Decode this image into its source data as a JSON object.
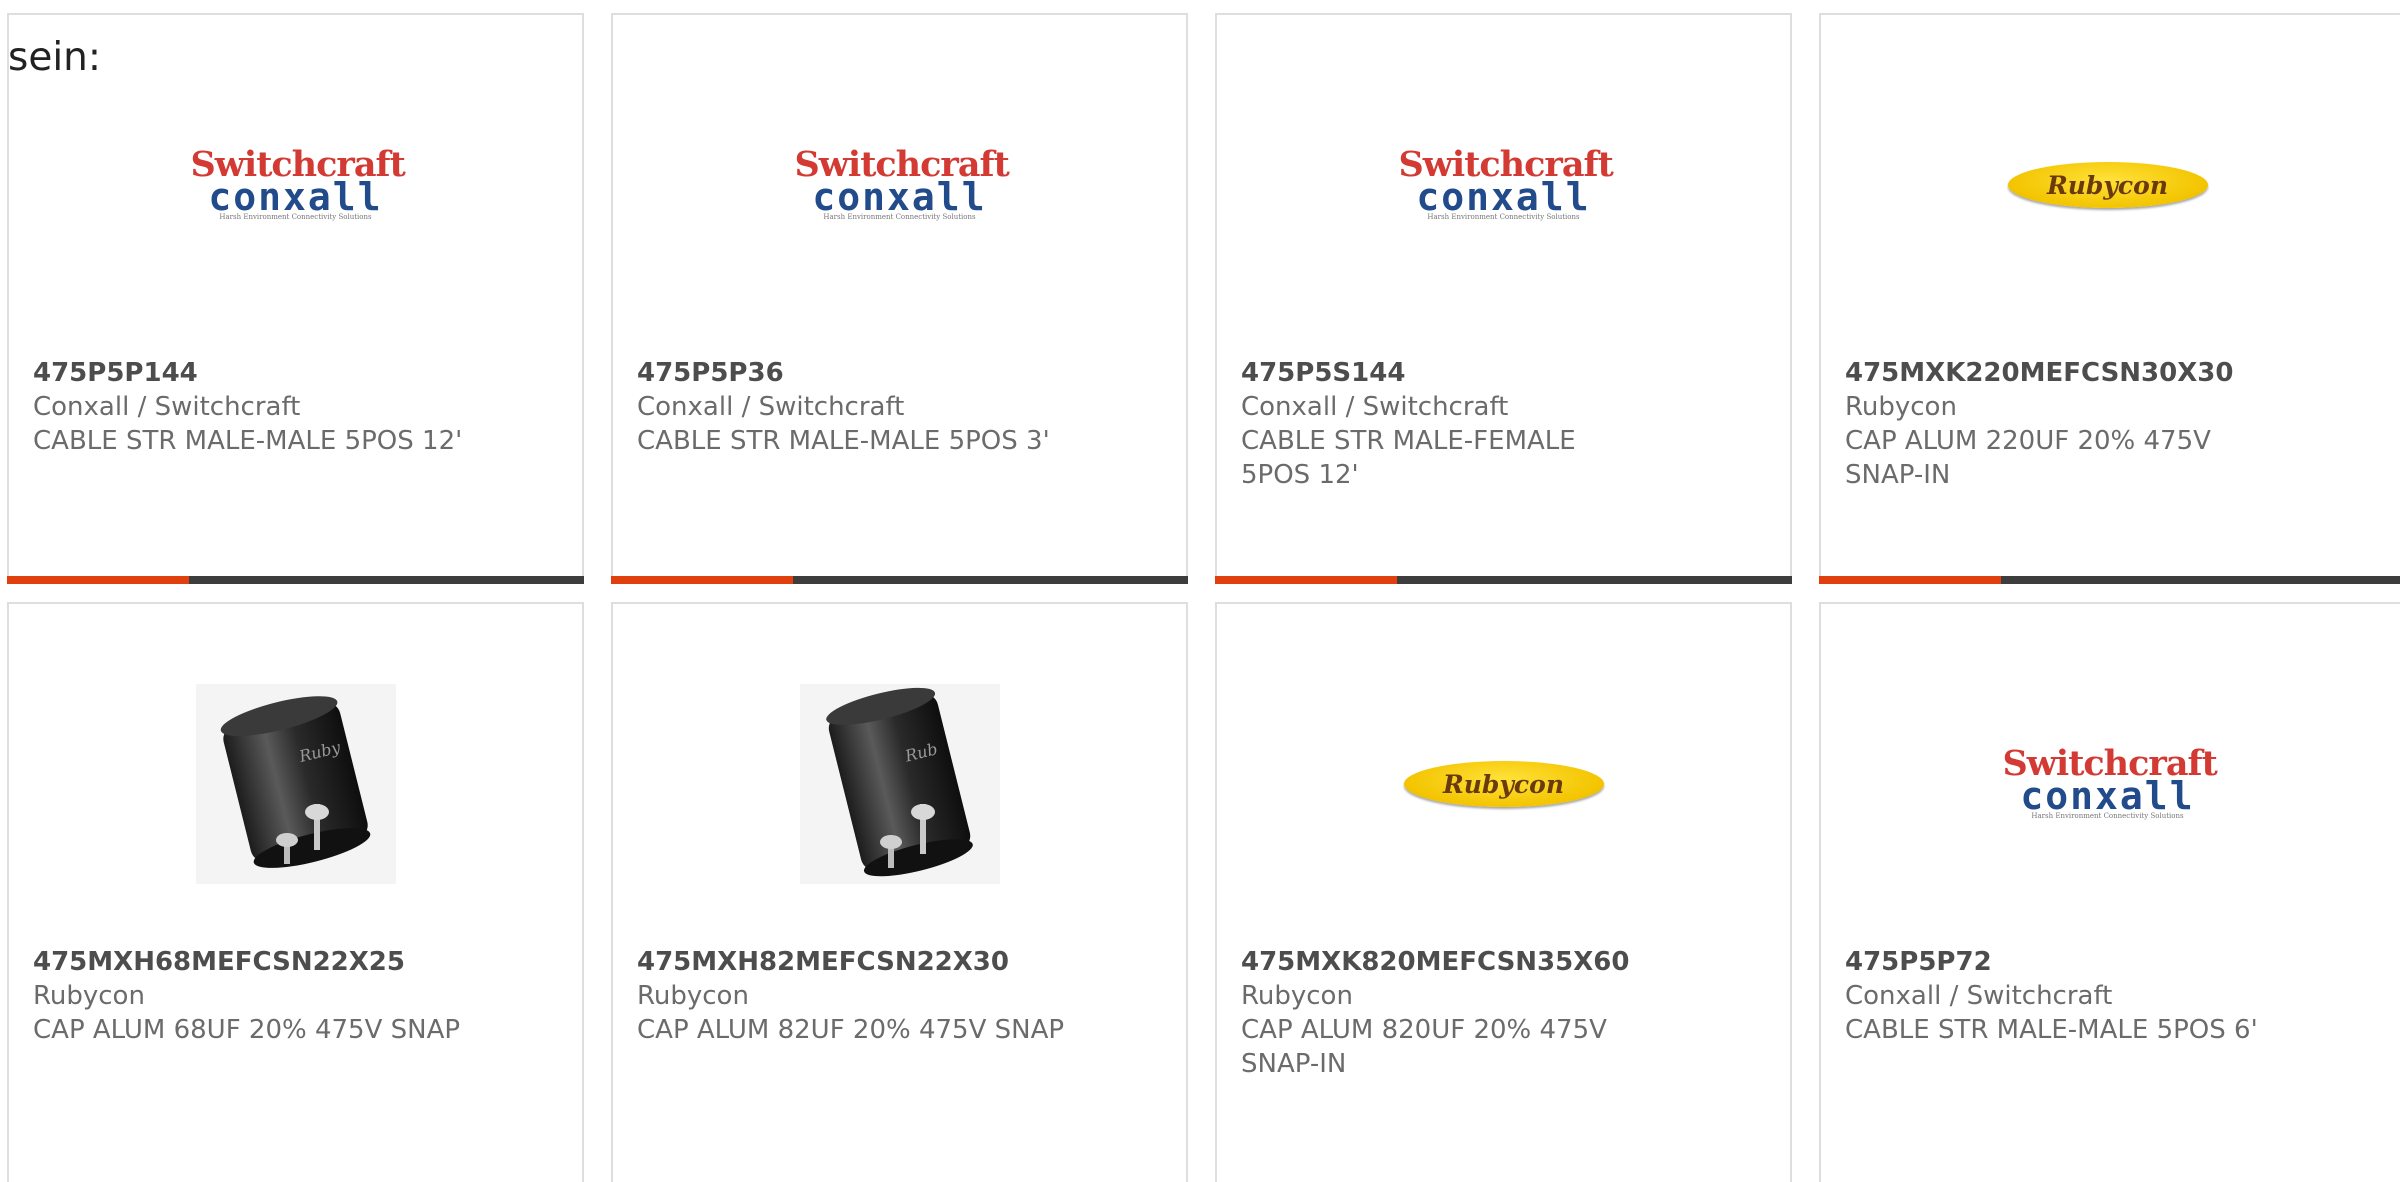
{
  "heading": "sein:",
  "colors": {
    "accent": "#e0400e",
    "bar": "#3d3d3d",
    "card_border": "#dedede",
    "text": "#6b6b6b"
  },
  "logos": {
    "switchcraft": {
      "line1": "Switchcraft",
      "line2": "conxall",
      "tagline": "Harsh Environment Connectivity Solutions"
    },
    "rubycon": {
      "text": "Rubycon"
    }
  },
  "products": [
    {
      "part": "475P5P144",
      "maker": "Conxall / Switchcraft",
      "desc": "CABLE STR MALE-MALE 5POS 12'",
      "image": "switchcraft-logo"
    },
    {
      "part": "475P5P36",
      "maker": "Conxall / Switchcraft",
      "desc": "CABLE STR MALE-MALE 5POS 3'",
      "image": "switchcraft-logo"
    },
    {
      "part": "475P5S144",
      "maker": "Conxall / Switchcraft",
      "desc": "CABLE STR MALE-FEMALE 5POS 12'",
      "image": "switchcraft-logo"
    },
    {
      "part": "475MXK220MEFCSN30X30",
      "maker": "Rubycon",
      "desc": "CAP ALUM 220UF 20% 475V SNAP-IN",
      "image": "rubycon-logo"
    },
    {
      "part": "475MXH68MEFCSN22X25",
      "maker": "Rubycon",
      "desc": "CAP ALUM 68UF 20% 475V SNAP",
      "image": "capacitor-photo"
    },
    {
      "part": "475MXH82MEFCSN22X30",
      "maker": "Rubycon",
      "desc": "CAP ALUM 82UF 20% 475V SNAP",
      "image": "capacitor-photo"
    },
    {
      "part": "475MXK820MEFCSN35X60",
      "maker": "Rubycon",
      "desc": "CAP ALUM 820UF 20% 475V SNAP-IN",
      "image": "rubycon-logo"
    },
    {
      "part": "475P5P72",
      "maker": "Conxall / Switchcraft",
      "desc": "CABLE STR MALE-MALE 5POS 6'",
      "image": "switchcraft-logo"
    }
  ]
}
